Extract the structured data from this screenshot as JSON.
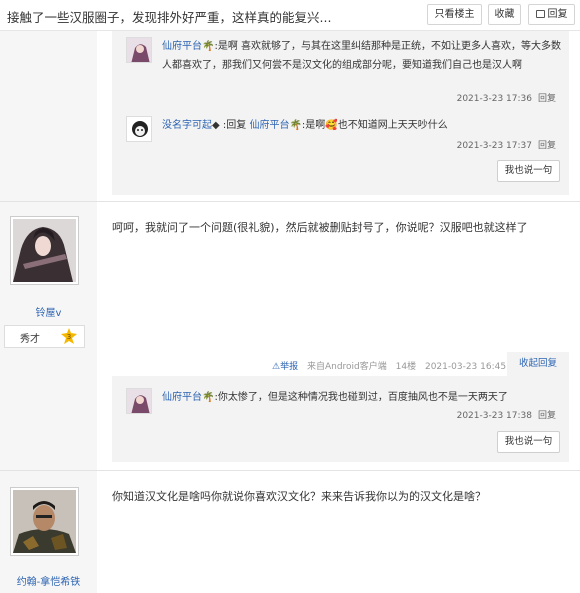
{
  "topbar": {
    "title": "接触了一些汉服圈子，发现排外好严重，这样真的能复兴...",
    "only_author": "只看楼主",
    "favorite": "收藏",
    "reply": "回复"
  },
  "floor1": {
    "replies": [
      {
        "user": "仙府平台",
        "text": ":是啊 喜欢就够了，与其在这里纠结那种是正统，不如让更多人喜欢，等大多数人都喜欢了，那我们又何尝不是汉文化的组成部分呢，要知道我们自己也是汉人啊",
        "time": "2021-3-23 17:36",
        "reply_label": "回复"
      },
      {
        "user": "没名字可起",
        "reply_prefix": ":回复",
        "reply_to": "仙府平台",
        "text": ":是啊",
        "text2": "也不知道网上天天吵什么",
        "time": "2021-3-23 17:37",
        "reply_label": "回复"
      }
    ],
    "say_button": "我也说一句"
  },
  "floor2": {
    "author": "铃屋v",
    "level_title": "秀才",
    "level_num": "3",
    "content": "呵呵，我就问了一个问题(很礼貌)，然后就被删贴封号了，你说呢？汉服吧也就这样了",
    "report": "举报",
    "device": "来自Android客户端",
    "floor": "14楼",
    "datetime": "2021-03-23 16:45",
    "collapse": "收起回复",
    "replies": [
      {
        "user": "仙府平台",
        "text": ":你太惨了，但是这种情况我也碰到过，百度抽风也不是一天两天了",
        "time": "2021-3-23 17:38",
        "reply_label": "回复"
      }
    ],
    "say_button": "我也说一句"
  },
  "floor3": {
    "author": "约翰-拿恺希铁",
    "content": "你知道汉文化是啥吗你就说你喜欢汉文化？来来告诉我你以为的汉文化是啥？"
  },
  "colors": {
    "link": "#2d64b3",
    "sidebar": "#f6f6f6",
    "reply_bg": "#f3f3f3"
  }
}
